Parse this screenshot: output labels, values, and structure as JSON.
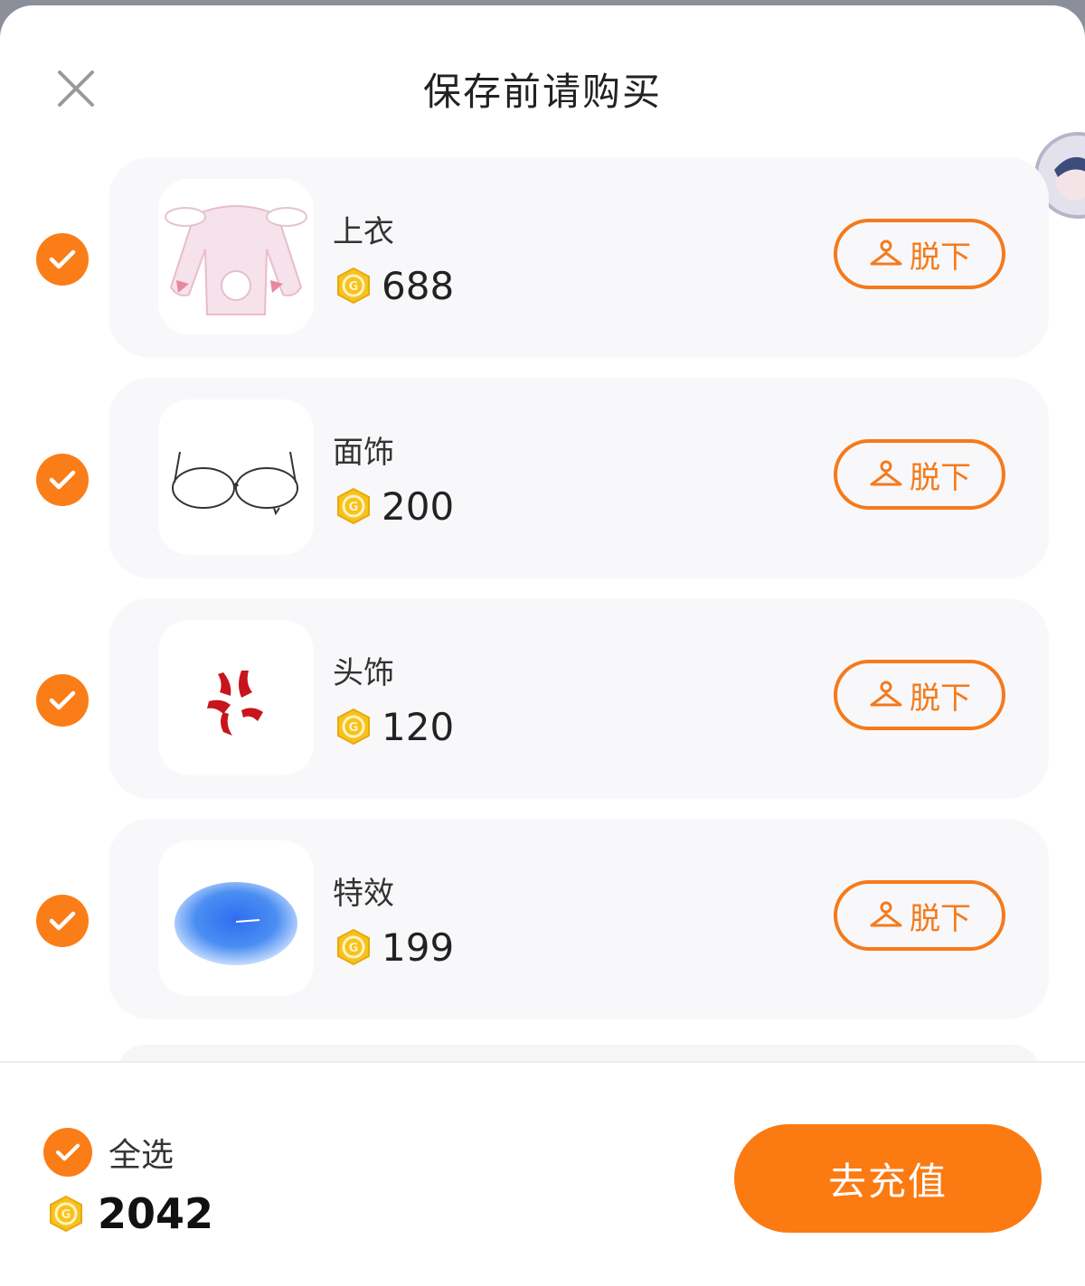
{
  "dialog": {
    "title": "保存前请购买"
  },
  "items": [
    {
      "name": "上衣",
      "price": "688",
      "action": "脱下"
    },
    {
      "name": "面饰",
      "price": "200",
      "action": "脱下"
    },
    {
      "name": "头饰",
      "price": "120",
      "action": "脱下"
    },
    {
      "name": "特效",
      "price": "199",
      "action": "脱下"
    }
  ],
  "footer": {
    "select_all_label": "全选",
    "total": "2042",
    "recharge_label": "去充值"
  },
  "colors": {
    "accent": "#fb7d17",
    "coin": "#f7c21c"
  },
  "icons": {
    "close": "close-icon",
    "check": "check-icon",
    "coin": "coin-icon",
    "hanger": "hanger-icon"
  }
}
